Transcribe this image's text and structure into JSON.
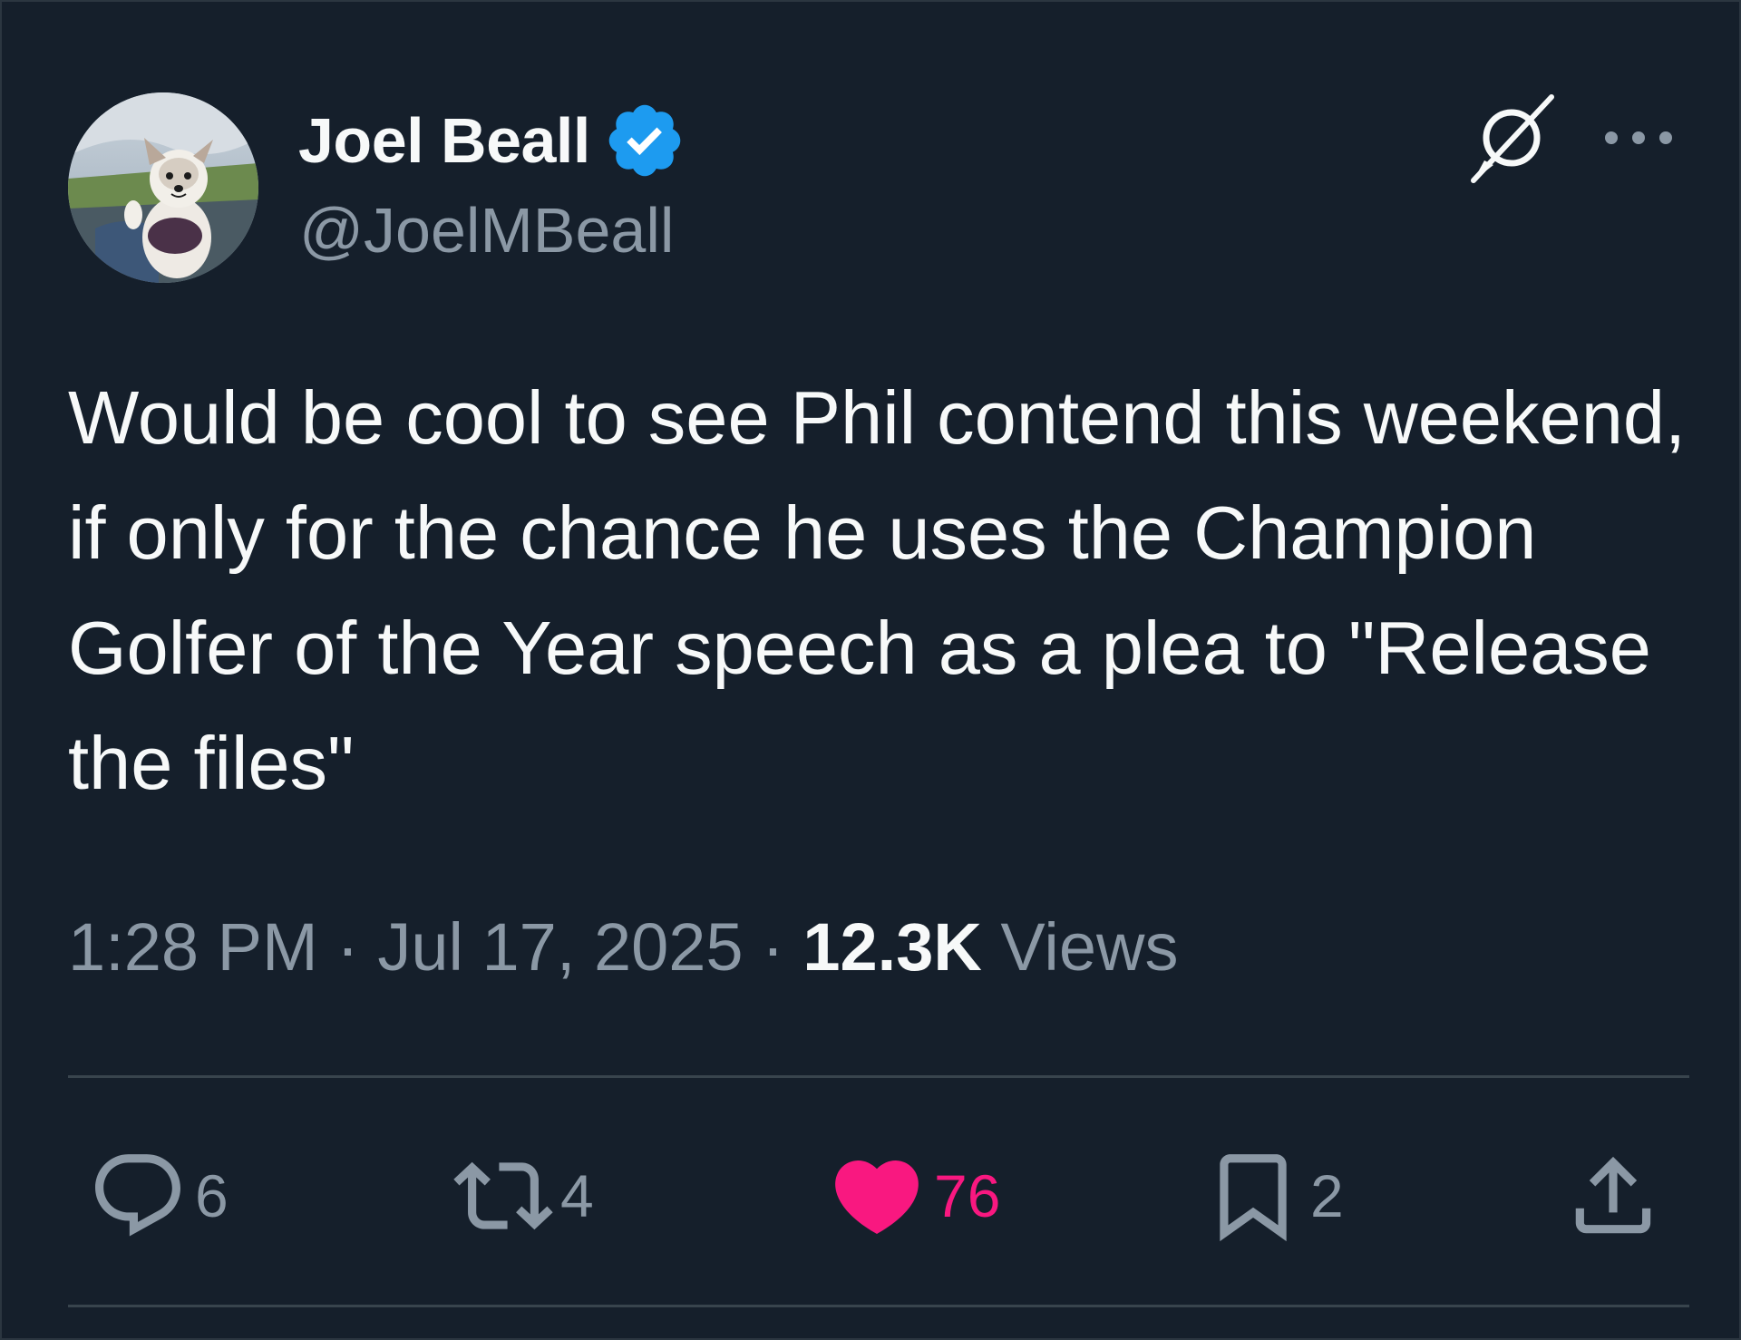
{
  "author": {
    "display_name": "Joel Beall",
    "handle": "@JoelMBeall",
    "verified": true,
    "verified_color": "#1d9bf0"
  },
  "header_icons": [
    "grok-icon",
    "more-icon"
  ],
  "tweet": {
    "text": "Would be cool to see Phil contend this weekend, if only for the chance he uses the Champion Golfer of the Year speech as a plea to \"Release the files\""
  },
  "meta": {
    "time": "1:28 PM",
    "separator": "·",
    "date": "Jul 17, 2025",
    "views_count": "12.3K",
    "views_label": "Views"
  },
  "actions": {
    "reply": {
      "icon": "reply-icon",
      "count": "6"
    },
    "retweet": {
      "icon": "retweet-icon",
      "count": "4"
    },
    "like": {
      "icon": "heart-icon",
      "count": "76",
      "active": true,
      "color": "#f91880"
    },
    "bookmark": {
      "icon": "bookmark-icon",
      "count": "2"
    },
    "share": {
      "icon": "share-icon"
    }
  },
  "colors": {
    "background": "#15202b",
    "primary_text": "#f7f9f9",
    "secondary_text": "#8b98a5",
    "divider": "#38444d"
  }
}
